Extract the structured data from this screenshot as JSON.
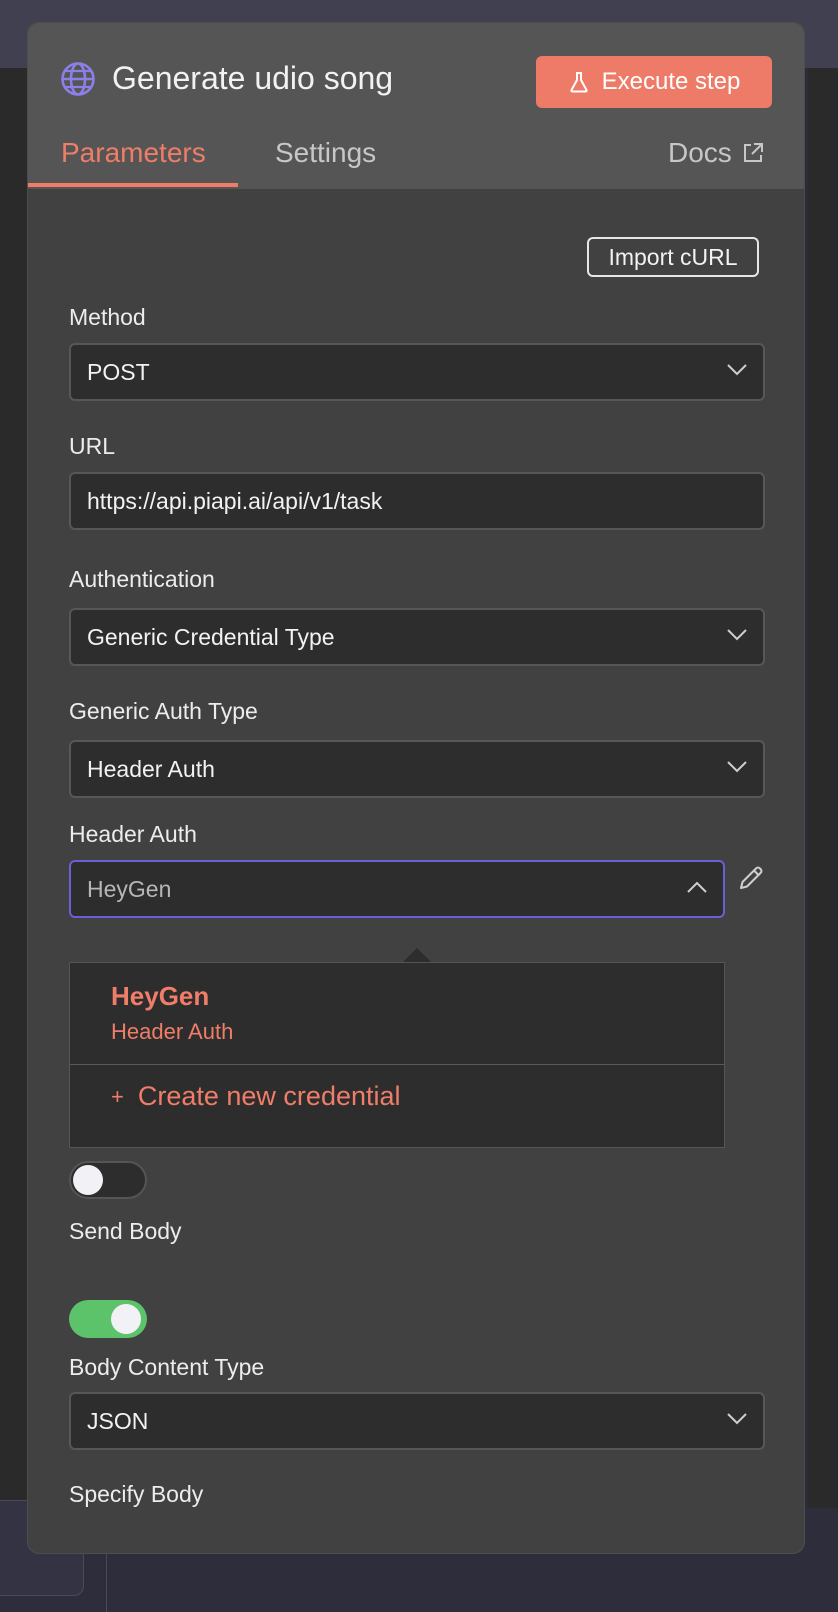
{
  "node": {
    "title": "Generate udio song",
    "execute_label": "Execute step"
  },
  "tabs": {
    "parameters": "Parameters",
    "settings": "Settings",
    "docs": "Docs"
  },
  "import_curl_label": "Import cURL",
  "fields": {
    "method": {
      "label": "Method",
      "value": "POST"
    },
    "url": {
      "label": "URL",
      "value": "https://api.piapi.ai/api/v1/task"
    },
    "authentication": {
      "label": "Authentication",
      "value": "Generic Credential Type"
    },
    "generic_auth_type": {
      "label": "Generic Auth Type",
      "value": "Header Auth"
    },
    "header_auth": {
      "label": "Header Auth",
      "value": "HeyGen"
    },
    "send_body": {
      "label": "Send Body",
      "enabled": true
    },
    "body_content_type": {
      "label": "Body Content Type",
      "value": "JSON"
    },
    "specify_body": {
      "label": "Specify Body"
    }
  },
  "hidden_toggle": {
    "enabled": false
  },
  "credential_dropdown": {
    "options": [
      {
        "name": "HeyGen",
        "type": "Header Auth"
      }
    ],
    "create_label": "Create new credential",
    "create_icon": "+"
  },
  "colors": {
    "accent": "#ef7d68",
    "execute_bg": "#ed7b67",
    "focus_border": "#6b5fd6",
    "toggle_on": "#5cc36a",
    "globe": "#8b7fe8"
  }
}
